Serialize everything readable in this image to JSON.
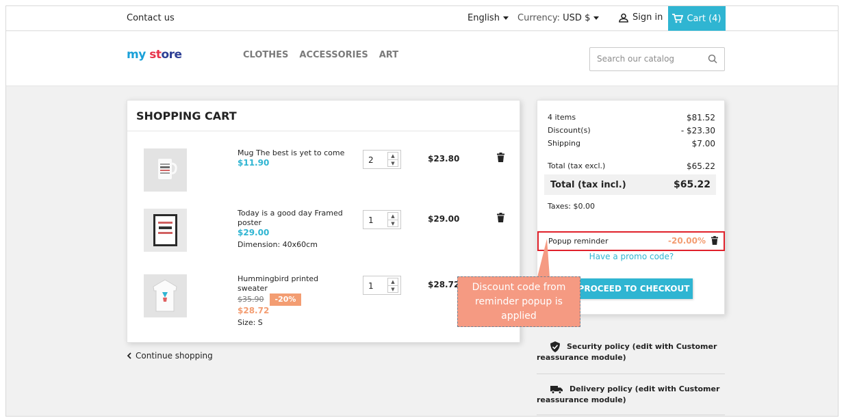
{
  "topnav": {
    "contact": "Contact us",
    "language": "English",
    "currency_label": "Currency:",
    "currency_value": "USD $",
    "signin": "Sign in",
    "cart": "Cart (4)"
  },
  "header": {
    "logo": {
      "part1": "my ",
      "part2": "st",
      "part3": "ore"
    },
    "menu": [
      "CLOTHES",
      "ACCESSORIES",
      "ART"
    ],
    "search_placeholder": "Search our catalog"
  },
  "cart": {
    "title": "SHOPPING CART",
    "items": [
      {
        "name": "Mug The best is yet to come",
        "price": "$11.90",
        "qty": "2",
        "total": "$23.80"
      },
      {
        "name": "Today is a good day Framed poster",
        "price": "$29.00",
        "attr": "Dimension: 40x60cm",
        "qty": "1",
        "total": "$29.00"
      },
      {
        "name": "Hummingbird printed sweater",
        "old_price": "$35.90",
        "discount": "-20%",
        "price": "$28.72",
        "attr": "Size: S",
        "qty": "1",
        "total": "$28.72"
      }
    ],
    "continue": "Continue shopping"
  },
  "summary": {
    "items_label": "4 items",
    "items_value": "$81.52",
    "discount_label": "Discount(s)",
    "discount_value": "- $23.30",
    "shipping_label": "Shipping",
    "shipping_value": "$7.00",
    "total_excl_label": "Total (tax excl.)",
    "total_excl_value": "$65.22",
    "total_incl_label": "Total (tax incl.)",
    "total_incl_value": "$65.22",
    "taxes": "Taxes: $0.00",
    "promo_name": "Popup reminder",
    "promo_value": "-20.00%",
    "have_promo": "Have a promo code?",
    "checkout": "PROCEED TO CHECKOUT"
  },
  "reassurance": {
    "security": "Security policy (edit with Customer reassurance module)",
    "delivery": "Delivery policy (edit with Customer reassurance module)"
  },
  "callout": "Discount code from reminder popup is applied",
  "colors": {
    "accent": "#2fb5d2",
    "discount": "#f39d72",
    "highlight": "#e0202a",
    "callout": "#f59a82"
  }
}
